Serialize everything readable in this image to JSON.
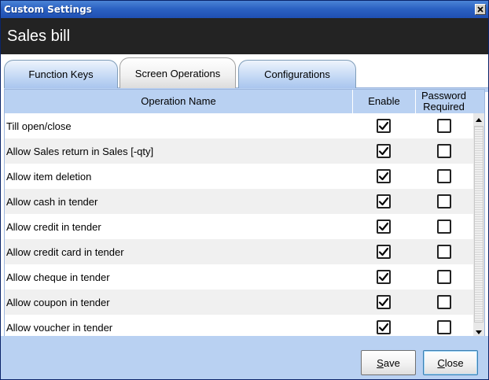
{
  "window": {
    "title": "Custom Settings"
  },
  "header": {
    "title": "Sales bill"
  },
  "tabs": [
    {
      "label": "Function Keys",
      "active": false
    },
    {
      "label": "Screen Operations",
      "active": true
    },
    {
      "label": "Configurations",
      "active": false
    }
  ],
  "grid": {
    "columns": {
      "name": "Operation Name",
      "enable": "Enable",
      "password_line1": "Password",
      "password_line2": "Required"
    },
    "rows": [
      {
        "name": "Till open/close",
        "enable": true,
        "password_required": false
      },
      {
        "name": "Allow Sales return in Sales [-qty]",
        "enable": true,
        "password_required": false
      },
      {
        "name": "Allow item deletion",
        "enable": true,
        "password_required": false
      },
      {
        "name": "Allow cash in tender",
        "enable": true,
        "password_required": false
      },
      {
        "name": "Allow credit in tender",
        "enable": true,
        "password_required": false
      },
      {
        "name": "Allow credit card in tender",
        "enable": true,
        "password_required": false
      },
      {
        "name": "Allow cheque in tender",
        "enable": true,
        "password_required": false
      },
      {
        "name": "Allow coupon in tender",
        "enable": true,
        "password_required": false
      },
      {
        "name": "Allow voucher in tender",
        "enable": true,
        "password_required": false
      }
    ]
  },
  "footer": {
    "save_label_underlined": "S",
    "save_label_rest": "ave",
    "close_label_underlined": "C",
    "close_label_rest": "lose"
  },
  "colors": {
    "titlebar": "#2c62c3",
    "header_bg": "#232323",
    "grid_header_bg": "#b9d1f2",
    "footer_bg": "#b9d1f2"
  },
  "icons": {
    "close": "close-icon",
    "scroll_up": "scroll-up-icon",
    "scroll_down": "scroll-down-icon",
    "check": "checkmark-icon"
  }
}
